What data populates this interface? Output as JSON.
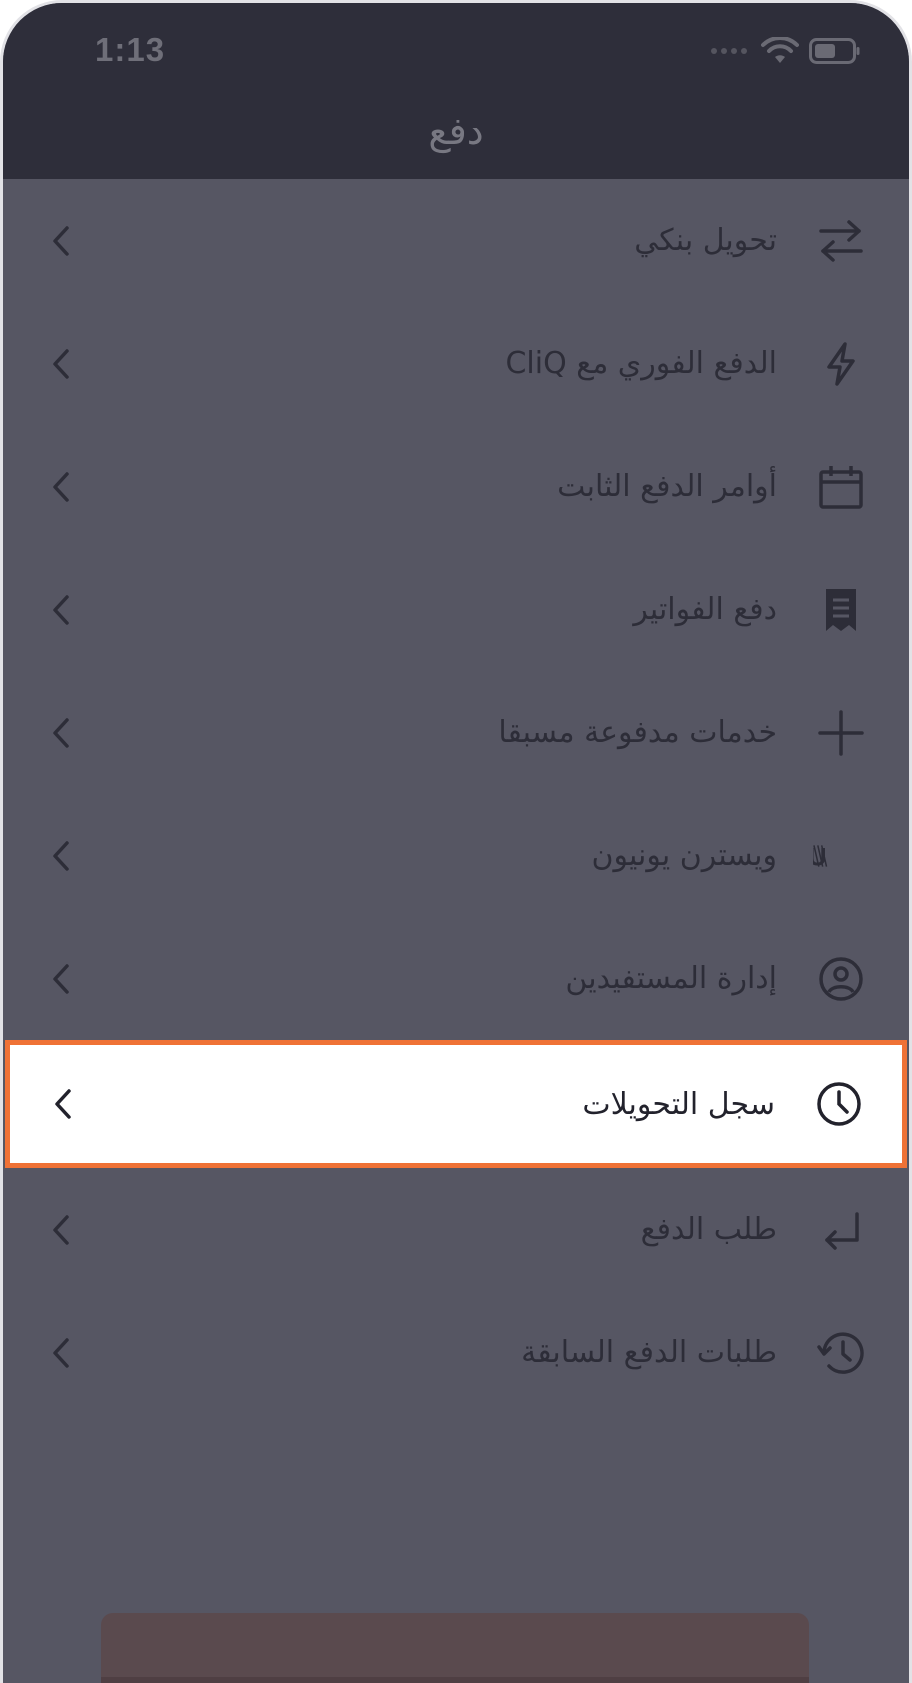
{
  "status_bar": {
    "time": "1:13",
    "icons": [
      "signal-dots-icon",
      "wifi-icon",
      "battery-icon"
    ]
  },
  "header": {
    "title": "دفع"
  },
  "menu": {
    "items": [
      {
        "label": "تحويل بنكي",
        "icon": "transfer-arrows-icon"
      },
      {
        "label": "الدفع الفوري مع CliQ",
        "icon": "lightning-icon"
      },
      {
        "label": "أوامر الدفع الثابت",
        "icon": "calendar-icon"
      },
      {
        "label": "دفع الفواتير",
        "icon": "receipt-icon"
      },
      {
        "label": "خدمات مدفوعة مسبقا",
        "icon": "plus-icon"
      },
      {
        "label": "ويسترن يونيون",
        "icon": "wu-logo-icon",
        "logo_text": "WU"
      },
      {
        "label": "إدارة المستفيدين",
        "icon": "user-circle-icon"
      },
      {
        "label": "سجل التحويلات",
        "icon": "clock-icon",
        "highlighted": true
      },
      {
        "label": "طلب الدفع",
        "icon": "return-arrow-icon"
      },
      {
        "label": "طلبات الدفع السابقة",
        "icon": "history-icon"
      }
    ]
  },
  "colors": {
    "overlay": "#565663",
    "topbar": "#2e2e3a",
    "highlight_border": "#ef7236",
    "icon_dark": "#2d2d38"
  }
}
